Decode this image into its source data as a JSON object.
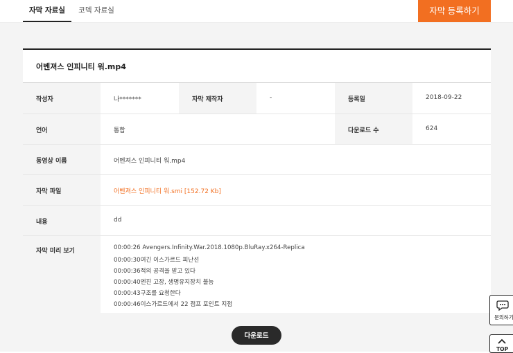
{
  "tabs": [
    {
      "label": "자막 자료실",
      "active": true
    },
    {
      "label": "코덱 자료실",
      "active": false
    }
  ],
  "register_button": "자막 등록하기",
  "title": "어벤져스 인피니티 워.mp4",
  "info": {
    "author_label": "작성자",
    "author_value": "나*******",
    "maker_label": "자막 제작자",
    "maker_value": "-",
    "date_label": "등록일",
    "date_value": "2018-09-22",
    "language_label": "언어",
    "language_value": "통합",
    "downloads_label": "다운로드 수",
    "downloads_value": "624",
    "video_label": "동영상 이름",
    "video_value": "어벤져스 인피니티 워.mp4",
    "file_label": "자막 파일",
    "file_value": "어벤져스 인피니티 워.smi [152.72 Kb]",
    "content_label": "내용",
    "content_value": "dd",
    "preview_label": "자막 미리 보기"
  },
  "preview_lines": [
    "00:00:26 Avengers.Infinity.War.2018.1080p.BluRay.x264-Replica",
    "00:00:30여긴 이스가르드 피난선",
    "00:00:36적의 공격을 받고 있다",
    "00:00:40엔진 고장, 생명유지장치 불능",
    "00:00:43구조를 요청한다",
    "00:00:46이스가르드에서 22 점프 포인트 지점"
  ],
  "download_button": "다운로드",
  "float": {
    "inquiry_label": "문의하기",
    "top_label": "TOP"
  },
  "colors": {
    "accent": "#f26f21",
    "dark_button": "#2a2a2a"
  },
  "icons": [
    "chat-bubble-icon",
    "chevron-up-icon"
  ]
}
